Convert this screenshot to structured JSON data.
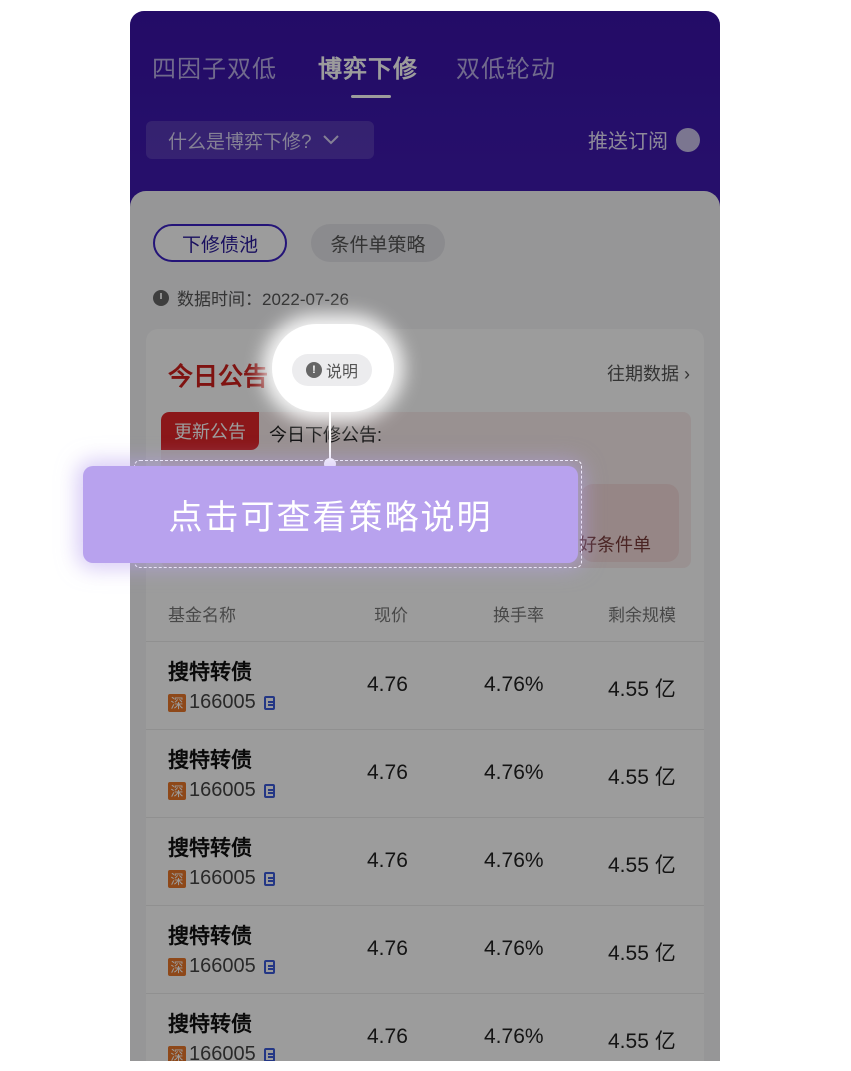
{
  "header": {
    "tabs": [
      "四因子双低",
      "博弈下修",
      "双低轮动"
    ],
    "what_is": "什么是博弈下修?",
    "subscribe": "推送订阅"
  },
  "filters": {
    "chips": [
      "下修债池",
      "条件单策略"
    ]
  },
  "data_time": "数据时间：2022-07-26",
  "notice": {
    "title": "今日公告",
    "explain": "说明",
    "history": "往期数据",
    "badge": "更新公告",
    "text": "今日下修公告:",
    "link_fragment": "置好条件单"
  },
  "table": {
    "headers": [
      "基金名称",
      "现价",
      "换手率",
      "剩余规模"
    ],
    "rows": [
      {
        "name": "搜特转债",
        "market": "深",
        "code": "166005",
        "price": "4.76",
        "turnover": "4.76%",
        "remaining": "4.55 亿"
      },
      {
        "name": "搜特转债",
        "market": "深",
        "code": "166005",
        "price": "4.76",
        "turnover": "4.76%",
        "remaining": "4.55 亿"
      },
      {
        "name": "搜特转债",
        "market": "深",
        "code": "166005",
        "price": "4.76",
        "turnover": "4.76%",
        "remaining": "4.55 亿"
      },
      {
        "name": "搜特转债",
        "market": "深",
        "code": "166005",
        "price": "4.76",
        "turnover": "4.76%",
        "remaining": "4.55 亿"
      },
      {
        "name": "搜特转债",
        "market": "深",
        "code": "166005",
        "price": "4.76",
        "turnover": "4.76%",
        "remaining": "4.55 亿"
      }
    ]
  },
  "guide": {
    "tooltip": "点击可查看策略说明"
  }
}
